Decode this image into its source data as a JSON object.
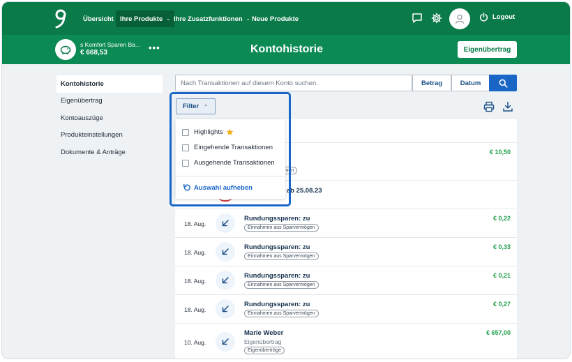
{
  "nav": {
    "items": [
      {
        "label": "Übersicht",
        "active": false,
        "dropdown": false
      },
      {
        "label": "Ihre Produkte",
        "active": true,
        "dropdown": true
      },
      {
        "label": "Ihre Zusatzfunktionen",
        "active": false,
        "dropdown": true
      },
      {
        "label": "Neue Produkte",
        "active": false,
        "dropdown": false
      }
    ],
    "icons": [
      "chat-icon",
      "gear-icon",
      "user-avatar-icon",
      "power-icon"
    ],
    "logout_label": "Logout"
  },
  "account": {
    "name": "s Komfort Sparen Ba...",
    "balance": "€ 668,53",
    "more": "•••",
    "icon": "piggy-bank-icon"
  },
  "page": {
    "title": "Kontohistorie",
    "transfer_button": "Eigenübertrag"
  },
  "sidebar": {
    "items": [
      {
        "label": "Kontohistorie",
        "active": true
      },
      {
        "label": "Eigenübertrag",
        "active": false
      },
      {
        "label": "Kontoauszüge",
        "active": false
      },
      {
        "label": "Produkteinstellungen",
        "active": false
      },
      {
        "label": "Dokumente & Anträge",
        "active": false
      }
    ]
  },
  "search": {
    "placeholder": "Nach Transaktionen auf diesem Konto suchen.",
    "betrag_label": "Betrag",
    "datum_label": "Datum"
  },
  "filter": {
    "button_label": "Filter",
    "options": [
      {
        "label": "Highlights",
        "checked": false,
        "star": true
      },
      {
        "label": "Eingehende Transaktionen",
        "checked": false
      },
      {
        "label": "Ausgehende Transaktionen",
        "checked": false
      }
    ],
    "reset_label": "Auswahl aufheben"
  },
  "partial": {
    "tag_fragment": "elmäßige Einnahmen",
    "title_fragment": "n 0,10000% ab 25.08.23"
  },
  "transactions": [
    {
      "date": "",
      "title": "",
      "sub": "",
      "tag": "elmäßige Einnahmen",
      "amount": "€ 10,50"
    },
    {
      "date": "18. Aug.",
      "title": "Rundungssparen: zu",
      "tag": "Einnahmen aus Sparvermögen",
      "amount": "€ 0,22"
    },
    {
      "date": "18. Aug.",
      "title": "Rundungssparen: zu",
      "tag": "Einnahmen aus Sparvermögen",
      "amount": "€ 0,33"
    },
    {
      "date": "18. Aug.",
      "title": "Rundungssparen: zu",
      "tag": "Einnahmen aus Sparvermögen",
      "amount": "€ 0,21"
    },
    {
      "date": "18. Aug.",
      "title": "Rundungssparen: zu",
      "tag": "Einnahmen aus Sparvermögen",
      "amount": "€ 0,27"
    },
    {
      "date": "10. Aug.",
      "title": "Marie Weber",
      "sub": "Eigenübertrag",
      "tag": "Eigenüberträge",
      "amount": "€ 657,00"
    }
  ],
  "colors": {
    "brand_green": "#0b7a49",
    "accent_blue": "#1a66c7",
    "amount_green": "#22a04b"
  }
}
